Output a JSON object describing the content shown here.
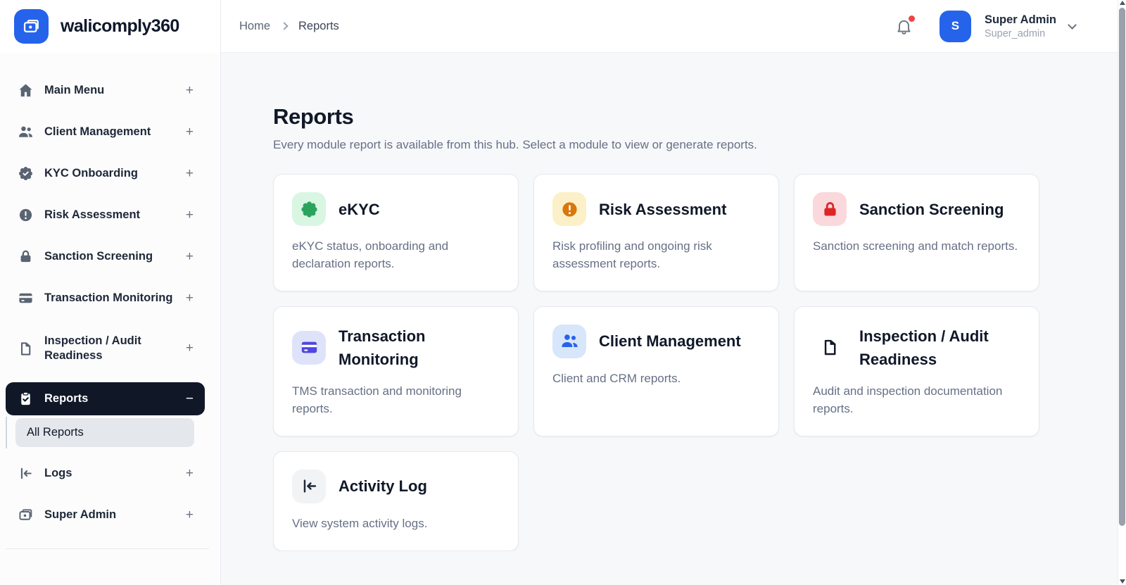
{
  "brand": {
    "name": "walicomply360"
  },
  "colors": {
    "accent": "#2563eb",
    "active_item_bg": "#101828",
    "notification_dot": "#ef4444",
    "sidebar_icon": "#5a6472"
  },
  "sidebar": {
    "items": [
      {
        "label": "Main Menu",
        "icon": "home",
        "suffix": "+"
      },
      {
        "label": "Client Management",
        "icon": "users",
        "suffix": "+"
      },
      {
        "label": "KYC Onboarding",
        "icon": "badge-check",
        "suffix": "+"
      },
      {
        "label": "Risk Assessment",
        "icon": "alert-circle",
        "suffix": "+"
      },
      {
        "label": "Sanction Screening",
        "icon": "lock",
        "suffix": "+"
      },
      {
        "label": "Transaction Monitoring",
        "icon": "credit-card",
        "suffix": "+"
      },
      {
        "label": "Inspection / Audit Readiness",
        "icon": "file",
        "suffix": "+",
        "two_line": true
      },
      {
        "label": "Reports",
        "icon": "clipboard-check",
        "suffix": "−",
        "active": true
      },
      {
        "label": "Logs",
        "icon": "arrow-left-to-line",
        "suffix": "+"
      },
      {
        "label": "Super Admin",
        "icon": "wallet",
        "suffix": "+"
      }
    ],
    "submenu": {
      "label": "All Reports"
    }
  },
  "header": {
    "breadcrumb": {
      "home": "Home",
      "current": "Reports"
    },
    "user": {
      "name": "Super Admin",
      "role": "Super_admin",
      "avatar_initial": "S"
    }
  },
  "page": {
    "title": "Reports",
    "subtitle": "Every module report is available from this hub. Select a module to view or generate reports."
  },
  "cards": [
    {
      "title": "eKYC",
      "description": "eKYC status, onboarding and declaration reports.",
      "icon": "seal",
      "icon_color": "#2aa45c",
      "icon_bg": "#d9f6e3"
    },
    {
      "title": "Risk Assessment",
      "description": "Risk profiling and ongoing risk assessment reports.",
      "icon": "alert-circle",
      "icon_color": "#d9770b",
      "icon_bg": "#fcf0c8"
    },
    {
      "title": "Sanction Screening",
      "description": "Sanction screening and match reports.",
      "icon": "lock",
      "icon_color": "#dc2626",
      "icon_bg": "#fbd8dc"
    },
    {
      "title": "Transaction Monitoring",
      "description": "TMS transaction and monitoring reports.",
      "icon": "credit-card",
      "icon_color": "#4f46e5",
      "icon_bg": "#dfe3fa"
    },
    {
      "title": "Client Management",
      "description": "Client and CRM reports.",
      "icon": "users",
      "icon_color": "#2563eb",
      "icon_bg": "#d7e6fb"
    },
    {
      "title": "Inspection / Audit Readiness",
      "description": "Audit and inspection documentation reports.",
      "icon": "file",
      "icon_color": "#111827",
      "icon_bg": "none"
    },
    {
      "title": "Activity Log",
      "description": "View system activity logs.",
      "icon": "arrow-left-to-line",
      "icon_color": "#1f2937",
      "icon_bg": "#f2f3f5"
    }
  ]
}
